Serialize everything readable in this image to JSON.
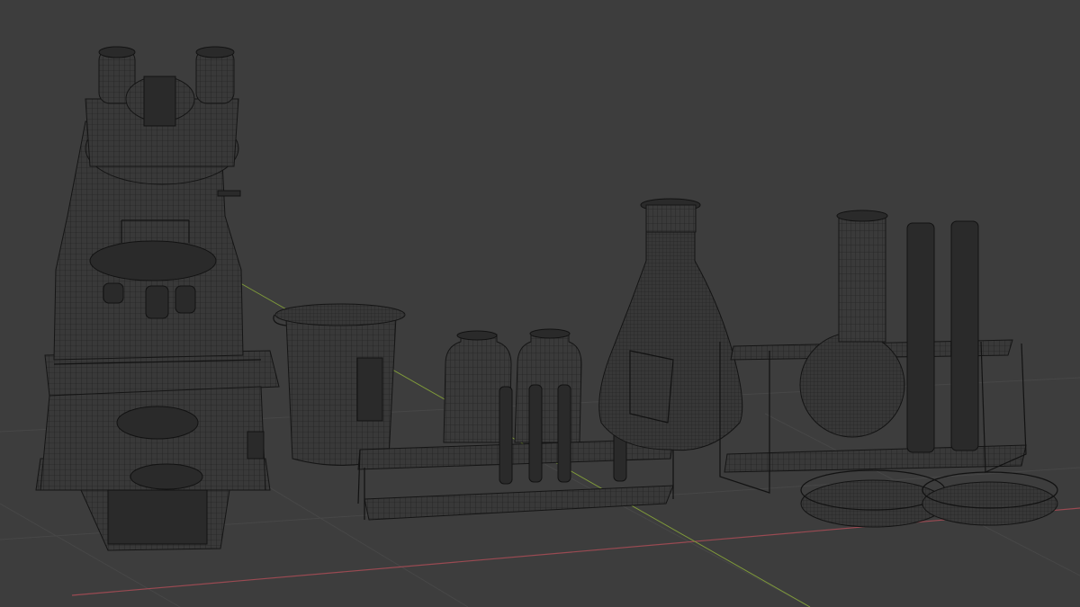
{
  "viewport": {
    "mode": "wireframe",
    "background_color": "#3d3d3d",
    "grid_color": "#474747",
    "wire_color": "#141414",
    "x_axis_color": "#9a4a52",
    "y_axis_color": "#7f9a3a"
  },
  "scene": {
    "objects": [
      "microscope",
      "beaker",
      "bottle-left",
      "bottle-right",
      "test-tube-rack-front",
      "erlenmeyer-flask",
      "round-bottom-flask",
      "test-tube-rack-right",
      "petri-dish-left",
      "petri-dish-right"
    ]
  }
}
